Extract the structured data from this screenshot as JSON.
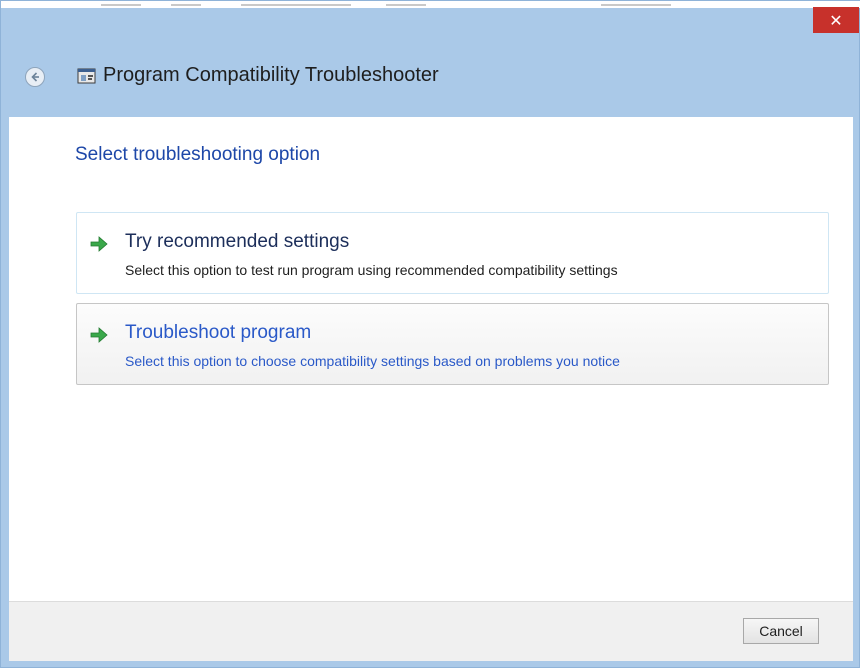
{
  "window": {
    "title": "Program Compatibility Troubleshooter",
    "close_label": "✕",
    "colors": {
      "frame": "#aac9e8",
      "close": "#c7312b",
      "heading": "#1d47a8",
      "link": "#2a59c8",
      "arrow_green": "#3aa84a"
    }
  },
  "header": {
    "back_icon": "back-arrow-icon",
    "app_icon": "troubleshooter-icon"
  },
  "main": {
    "heading": "Select troubleshooting option",
    "options": [
      {
        "icon": "green-arrow-icon",
        "title": "Try recommended settings",
        "description": "Select this option to test run program using recommended compatibility settings"
      },
      {
        "icon": "green-arrow-icon",
        "title": "Troubleshoot program",
        "description": "Select this option to choose compatibility settings based on problems you notice"
      }
    ]
  },
  "footer": {
    "cancel_label": "Cancel"
  }
}
